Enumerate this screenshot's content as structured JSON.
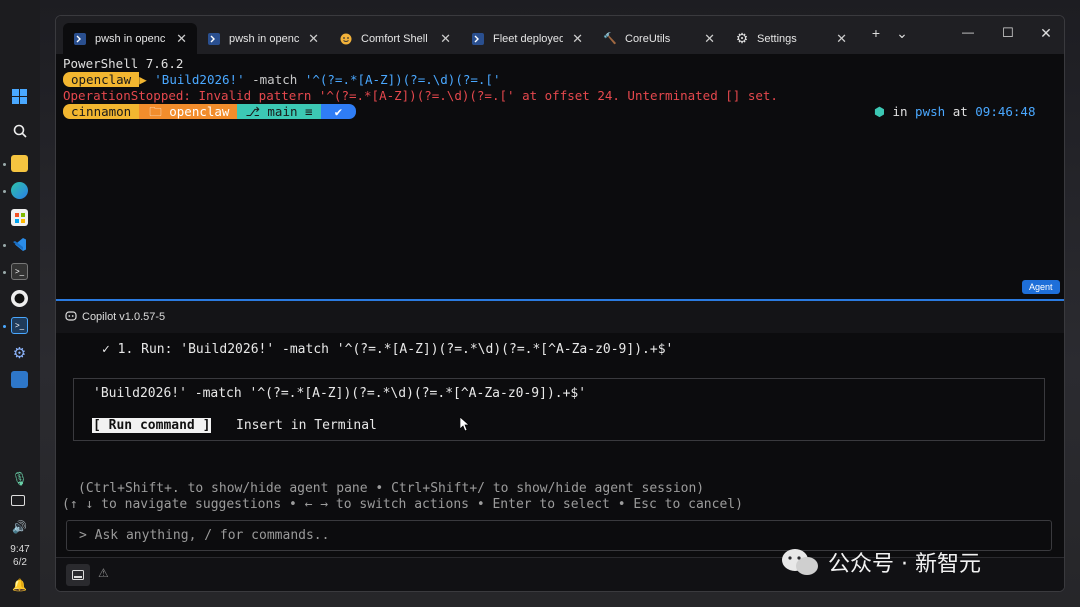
{
  "taskbar": {
    "time": "9:47",
    "date": "6/2"
  },
  "tabs": [
    {
      "label": "pwsh in openc",
      "icon": "powershell-icon"
    },
    {
      "label": "pwsh in opencl",
      "icon": "powershell-icon"
    },
    {
      "label": "Comfort Shell -",
      "icon": "smiley-icon"
    },
    {
      "label": "Fleet deployed",
      "icon": "powershell-icon"
    },
    {
      "label": "CoreUtils",
      "icon": "hammer-icon"
    },
    {
      "label": "Settings",
      "icon": "gear-icon"
    }
  ],
  "tab_controls": {
    "new": "+",
    "dropdown": "⌄"
  },
  "window_controls": {
    "minimize": "—",
    "maximize": "☐",
    "close": "✕"
  },
  "terminal": {
    "banner": "PowerShell 7.6.2",
    "prompt1_dir": "openclaw",
    "cmd1_string": "'Build2026!'",
    "cmd1_op": " -match ",
    "cmd1_pattern": "'^(?=.*[A-Z])(?=.\\d)(?=.['",
    "error_line": "OperationStopped: Invalid pattern '^(?=.*[A-Z])(?=.\\d)(?=.[' at offset 24. Unterminated [] set.",
    "prompt2_user": "cinnamon",
    "prompt2_dir": "openclaw",
    "prompt2_branch": "main ≡",
    "prompt2_status": "✔",
    "right_status_in": "in",
    "right_status_shell": "pwsh",
    "right_status_at": "at",
    "right_status_time": "09:46:48",
    "agent_badge": "Agent"
  },
  "copilot": {
    "header": "Copilot v1.0.57-5",
    "step": "✓ 1. Run: 'Build2026!' -match '^(?=.*[A-Z])(?=.*\\d)(?=.*[^A-Za-z0-9]).+$'",
    "command": "'Build2026!' -match '^(?=.*[A-Z])(?=.*\\d)(?=.*[^A-Za-z0-9]).+$'",
    "run_label": "[ Run command ]",
    "insert_label": "Insert in Terminal",
    "hint1": "(Ctrl+Shift+. to show/hide agent pane • Ctrl+Shift+/ to show/hide agent session)",
    "hint2": "(↑ ↓ to navigate suggestions • ← → to switch actions • Enter to select • Esc to cancel)",
    "ask_placeholder": "> Ask anything, / for commands.."
  },
  "watermark": {
    "text": "公众号 · 新智元"
  },
  "colors": {
    "prompt_yellow": "#f2b630",
    "prompt_orange": "#f28d2c",
    "prompt_teal": "#3cc8b4",
    "prompt_blue": "#2f7df5",
    "error_red": "#e5484d",
    "string_blue": "#4aa8ff",
    "accent_blue": "#2b7be0"
  }
}
